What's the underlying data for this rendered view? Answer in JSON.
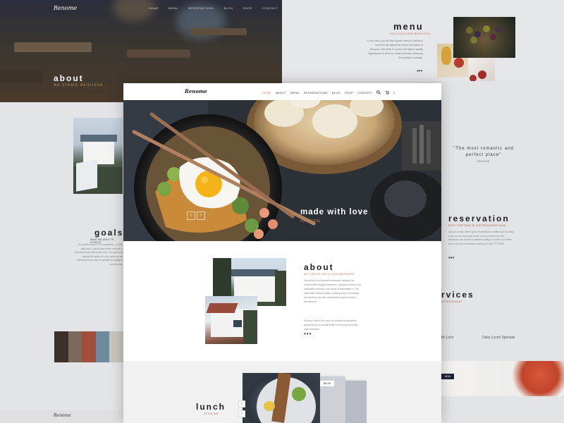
{
  "brand": {
    "name": "Renome"
  },
  "bg_hero": {
    "nav_items": [
      "HOME",
      "MENU",
      "RESERVATIONS",
      "BLOG",
      "SHOP",
      "CONTACT"
    ],
    "title": "about",
    "subtitle": "we create delicious"
  },
  "bg_menu": {
    "title": "menu",
    "subtitle": "DELICIOUS AND BEAUTIFUL",
    "text": "In our menu you will find a great variety of delicious food that will satisfy the needs and tastes of everyone. We strive to source the highest quality ingredients for all of our dishes thereby enhancing the quality of services.",
    "more": "•••"
  },
  "bg_goals": {
    "title": "goals",
    "subtitle": "WHAT WE WANT TO ACHIEVE",
    "text": "Our guests come for all occasions – a drink after work, a quick bite before a movie, a business dinner and much more. Our goal is to satisfy the needs of every visitor so our restaurant every day for getting the quality of our services.",
    "footer_logo": "Renome"
  },
  "bg_right": {
    "quote": "\"The most romantic and perfect place\"",
    "quote_author": "JOHN DOE",
    "reservation_title": "reservation",
    "reservation_sub": "BOOK YOUR TABLE AT OUR RESTAURANT NOW!",
    "reservation_text": "Call you on the date of your reservation to confirm your booking. If you do not receive an email, or do not hear from the restaurant, we would recommend calling to confirm your table and verify your reservation booking (+) 800 777 55 55.",
    "reservation_more": "•••",
    "services_title": "rvices",
    "services_sub": "UR RESTAURANT",
    "service_1": "ith Love",
    "service_2": "Daily Lunch Specials",
    "badge": "NEW"
  },
  "card": {
    "logo": "Renome",
    "nav": [
      {
        "label": "HOME",
        "active": true
      },
      {
        "label": "ABOUT",
        "active": false
      },
      {
        "label": "MENU",
        "active": false
      },
      {
        "label": "RESERVATIONS",
        "active": false
      },
      {
        "label": "BLOG",
        "active": false
      },
      {
        "label": "SHOP",
        "active": false
      },
      {
        "label": "CONTACT",
        "active": false
      }
    ],
    "search_icon": "search-icon",
    "cart_icon": "cart-icon",
    "cart_count": "0",
    "hero": {
      "title": "made with love",
      "subtitle": "for you",
      "prev": "‹",
      "next": "›"
    },
    "about": {
      "title": "about",
      "subtitle": "WE CREATE DELICIOUS MEMORIES",
      "para1": "Renome is a renowned restaurant delights the senses with elegant ambience, gracious service and delectable menus in the heart of Manhattan's. The distinctive setting boasts contemporary furnishings and finishes plus the restaurant's grand modern architecture.",
      "para2": "Renome offers the room for private dining where guests enjoy a cocktail buffet and sumptuous late-night desserts.",
      "more": "•••"
    },
    "lunch": {
      "title": "lunch",
      "subtitle": "OF THE DAY",
      "up": "‹",
      "down": "›",
      "price": "$9.95"
    }
  },
  "colors": {
    "accent": "#c06a45",
    "dark": "#1e1e1e",
    "navy": "#1c2333"
  }
}
